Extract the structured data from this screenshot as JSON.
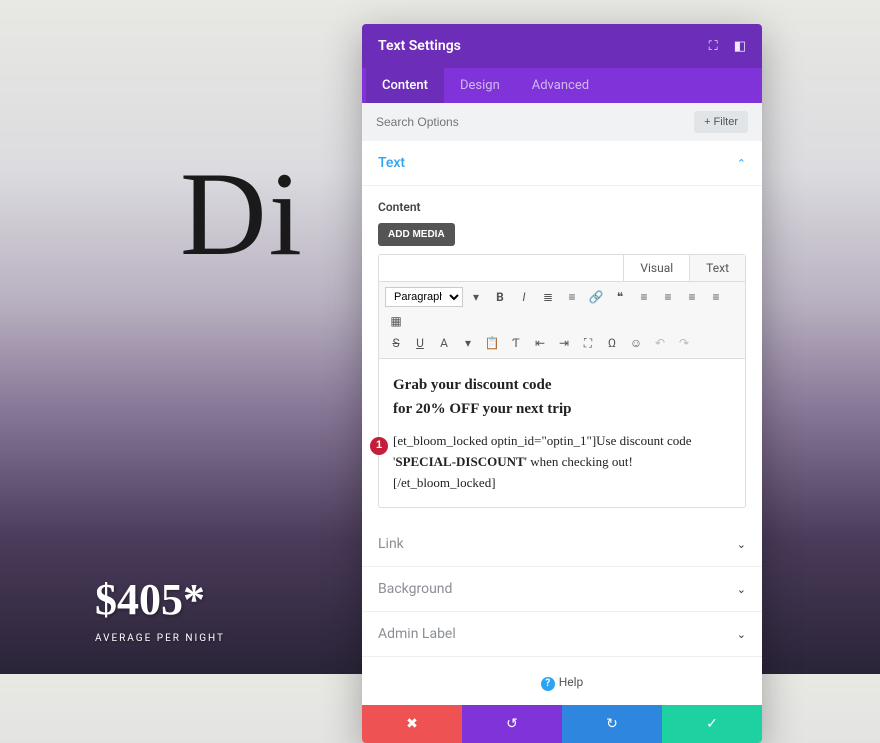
{
  "background": {
    "heading_partial": "Di",
    "price": "$405*",
    "price_subtitle": "AVERAGE PER NIGHT"
  },
  "modal": {
    "title": "Text Settings",
    "tabs": {
      "content": "Content",
      "design": "Design",
      "advanced": "Advanced"
    },
    "search": {
      "placeholder": "Search Options",
      "filter_label": "+  Filter"
    },
    "sections": {
      "text": "Text",
      "link": "Link",
      "background": "Background",
      "admin_label": "Admin Label"
    },
    "text_section": {
      "content_label": "Content",
      "add_media": "ADD MEDIA",
      "editor_tabs": {
        "visual": "Visual",
        "text": "Text"
      },
      "paragraph_select": "Paragraph",
      "body": {
        "line1": "Grab your discount code",
        "line2": "for 20% OFF your next trip",
        "shortcode_pre": "[et_bloom_locked optin_id=\"optin_1\"]Use discount code '",
        "shortcode_bold": "SPECIAL-DISCOUNT",
        "shortcode_post": "' when checking out! [/et_bloom_locked]"
      }
    },
    "annotation": "1",
    "help": "Help"
  },
  "icons": {
    "bold": "B",
    "italic": "I",
    "ul": "≣",
    "ol": "≡",
    "link": "🔗",
    "quote": "❝",
    "alignl": "≡",
    "alignc": "≡",
    "alignr": "≡",
    "justify": "≡",
    "strike": "S",
    "underline": "U",
    "color": "A",
    "paste": "📋",
    "clear": "Ƭ",
    "outdent": "⇤",
    "indent": "⇥",
    "expand": "⛶",
    "omega": "Ω",
    "emoji": "☺",
    "undo": "↶",
    "redo": "↷"
  },
  "footer_icons": {
    "cancel": "✖",
    "undo": "↺",
    "redo": "↻",
    "save": "✓"
  }
}
